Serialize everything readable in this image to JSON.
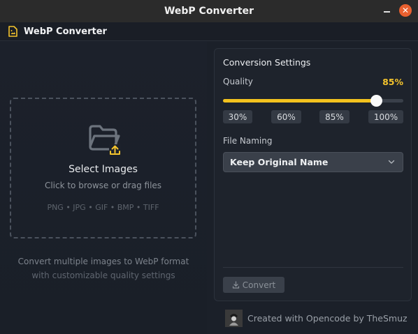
{
  "window": {
    "title": "WebP Converter",
    "minimize_icon": "minimize-icon",
    "close_icon": "close-icon",
    "close_color": "#e9602f"
  },
  "header": {
    "app_title": "WebP Converter",
    "logo_icon": "image-file-icon",
    "accent": "#f5c42c"
  },
  "dropzone": {
    "icon": "folder-upload-icon",
    "title": "Select Images",
    "subtitle": "Click to browse or drag files",
    "formats": "PNG • JPG • GIF • BMP • TIFF"
  },
  "left_description": {
    "line1": "Convert multiple images to WebP format",
    "line2": "with customizable quality settings"
  },
  "settings": {
    "title": "Conversion Settings",
    "quality_label": "Quality",
    "quality_value_text": "85%",
    "quality_value": 85,
    "presets": [
      "30%",
      "60%",
      "85%",
      "100%"
    ],
    "file_naming_label": "File Naming",
    "file_naming_value": "Keep Original Name",
    "convert_label": "Convert"
  },
  "footer": {
    "text": "Created with Opencode by TheSmuz"
  }
}
